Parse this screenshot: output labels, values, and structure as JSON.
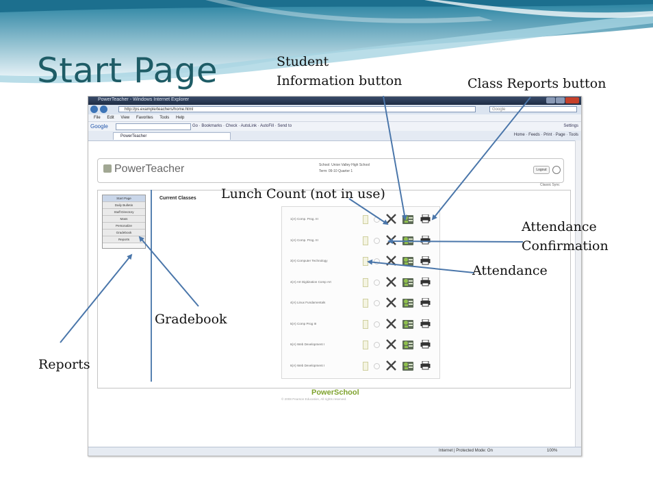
{
  "slide": {
    "title": "Start Page",
    "callouts": {
      "student_info": [
        "Student",
        "Information button"
      ],
      "class_reports": "Class Reports button",
      "lunch_count": "Lunch Count (not in use)",
      "attendance_confirmation": [
        "Attendance",
        "Confirmation"
      ],
      "attendance": "Attendance",
      "gradebook": "Gradebook",
      "reports": "Reports"
    },
    "colors": {
      "title": "#1e5c66",
      "arrow": "#4a76aa",
      "banner": "#2f86a8"
    }
  },
  "browser": {
    "title": "PowerTeacher - Windows Internet Explorer",
    "address": "http://ps.example/teachers/home.html",
    "search_placeholder": "Google",
    "menu": [
      "File",
      "Edit",
      "View",
      "Favorites",
      "Tools",
      "Help"
    ],
    "google_label": "Google",
    "google_tools": "Go  ·  Bookmarks  ·  Check  ·  AutoLink  ·  AutoFill  ·  Send to",
    "settings_label": "Settings",
    "tab_label": "PowerTeacher",
    "command_bar": "Home  ·  Feeds  ·  Print  ·  Page  ·  Tools",
    "status_zone": "Internet | Protected Mode: On",
    "status_zoom": "100%"
  },
  "page": {
    "logo": "PowerTeacher",
    "school_line": "School: Union Valley High School",
    "term_line": "Term: 09-10 Quarter 1",
    "logout_label": "Logout",
    "sub_header": "Classic  Sync",
    "nav": [
      "Start Page",
      "Daily Bulletin",
      "Staff Directory",
      "Mass",
      "Personalize",
      "Gradebook",
      "Reports"
    ],
    "current_classes_label": "Current Classes",
    "classes": [
      "1(A)  Comp. Prog. III",
      "1(A)  Comp. Prog. III",
      "3(A)  Computer Technology",
      "4(A)  Art Digitization Comp Art",
      "4(A)  Linux Fundamentals",
      "5(A)  Comp Prog III",
      "6(A)  Web Development I",
      "6(A)  Web Development I"
    ],
    "footer_brand": "PowerSchool",
    "copyright": "© 2008 Pearson Education, All rights reserved."
  }
}
